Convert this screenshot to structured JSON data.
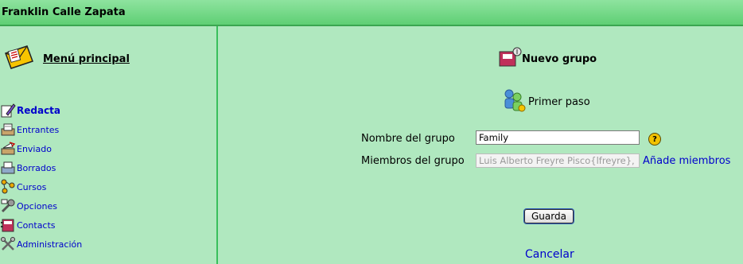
{
  "header": {
    "user_name": "Franklin Calle Zapata"
  },
  "sidebar": {
    "title": "Menú principal",
    "items": [
      {
        "label": "Redacta",
        "icon": "compose-icon",
        "bold": true
      },
      {
        "label": "Entrantes",
        "icon": "inbox-icon",
        "bold": false
      },
      {
        "label": "Enviado",
        "icon": "sent-icon",
        "bold": false
      },
      {
        "label": "Borrados",
        "icon": "trash-icon",
        "bold": false
      },
      {
        "label": "Cursos",
        "icon": "courses-icon",
        "bold": false
      },
      {
        "label": "Opciones",
        "icon": "options-icon",
        "bold": false
      },
      {
        "label": "Contacts",
        "icon": "contacts-icon",
        "bold": false
      },
      {
        "label": "Administración",
        "icon": "admin-icon",
        "bold": false
      }
    ]
  },
  "main": {
    "heading": "Nuevo grupo",
    "step": "Primer paso",
    "form": {
      "group_name_label": "Nombre del grupo",
      "group_name_value": "Family",
      "members_label": "Miembros del grupo",
      "members_value": "Luis Alberto Freyre Pisco{lfreyre},",
      "add_members_link": "Añade miembros"
    },
    "save_button": "Guarda",
    "cancel_link": "Cancelar"
  },
  "colors": {
    "background": "#b0e8bf",
    "header": "#5fcf74",
    "link": "#0000cc",
    "divider": "#39bf5c"
  }
}
